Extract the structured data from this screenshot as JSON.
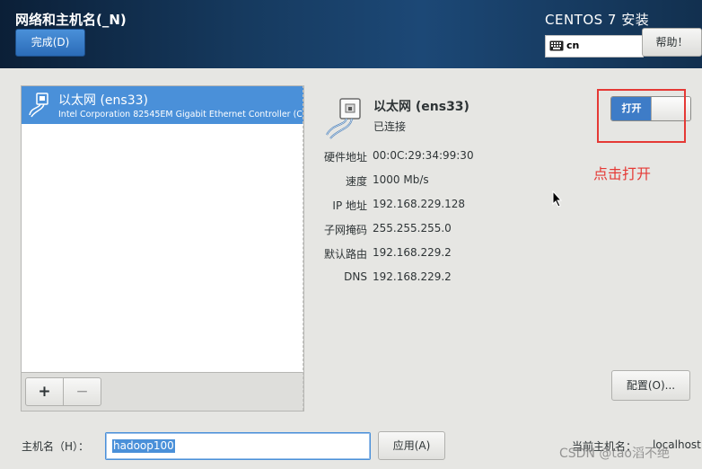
{
  "header": {
    "title": "网络和主机名(_N)",
    "done_label": "完成(D)",
    "product": "CENTOS 7 安装",
    "keyboard_layout": "cn",
    "help_label": "帮助！"
  },
  "device_list": {
    "items": [
      {
        "name": "以太网 (ens33)",
        "description": "Intel Corporation 82545EM Gigabit Ethernet Controller (C",
        "selected": true,
        "icon": "ethernet-cable-icon"
      }
    ],
    "add_label": "+",
    "remove_label": "−"
  },
  "detail": {
    "name": "以太网 (ens33)",
    "status": "已连接",
    "toggle_label": "打开",
    "toggle_state": "on",
    "rows": [
      {
        "label": "硬件地址",
        "value": "00:0C:29:34:99:30"
      },
      {
        "label": "速度",
        "value": "1000 Mb/s"
      },
      {
        "label": "IP 地址",
        "value": "192.168.229.128"
      },
      {
        "label": "子网掩码",
        "value": "255.255.255.0"
      },
      {
        "label": "默认路由",
        "value": "192.168.229.2"
      },
      {
        "label": "DNS",
        "value": "192.168.229.2"
      }
    ],
    "config_label": "配置(O)..."
  },
  "annotation": {
    "text": "点击打开",
    "color": "#e53935"
  },
  "hostname": {
    "label": "主机名（H）：",
    "value": "hadoop100",
    "apply_label": "应用(A)",
    "current_label": "当前主机名：",
    "current_value": "localhost"
  },
  "watermark": "CSDN @tao滔不绝",
  "colors": {
    "accent": "#4a90d9",
    "header_dark": "#0b1f37",
    "annotation": "#e53935"
  }
}
